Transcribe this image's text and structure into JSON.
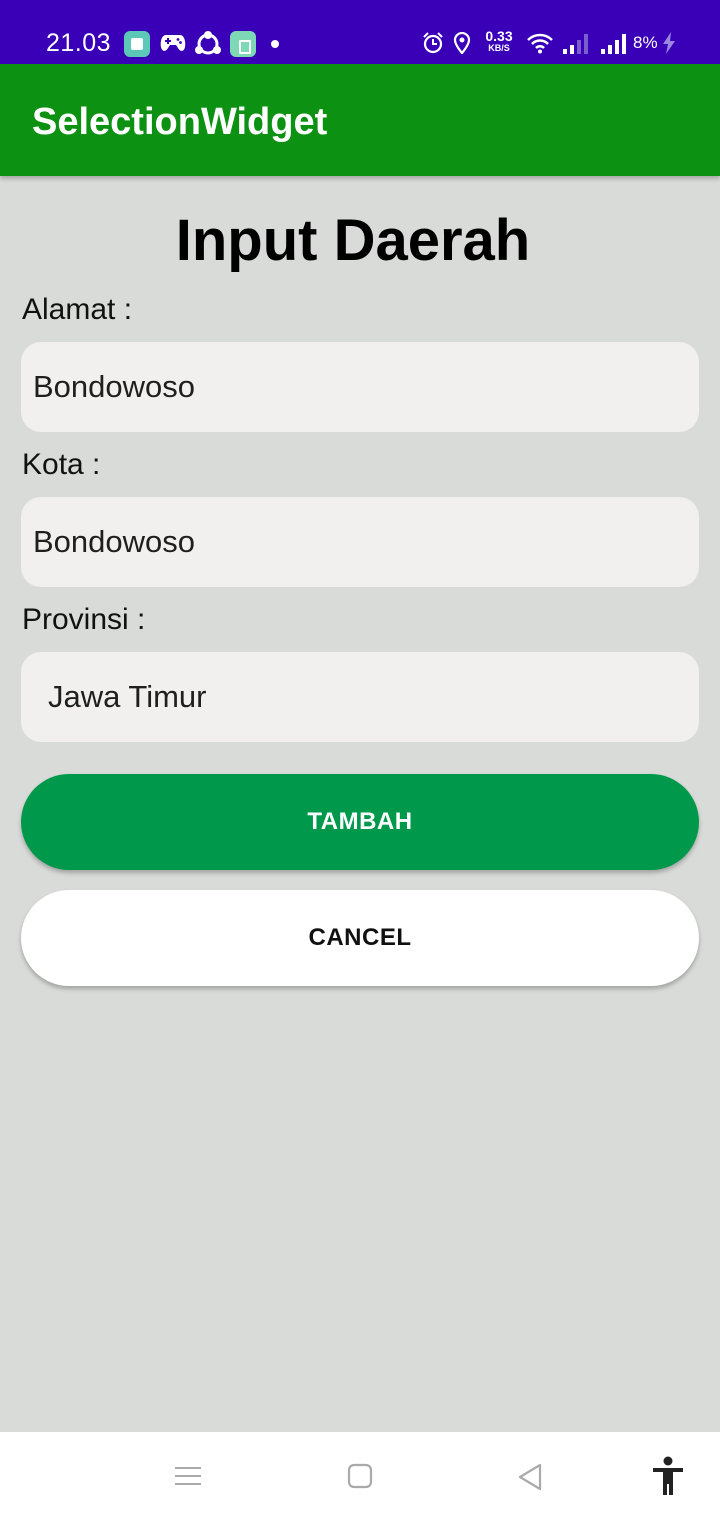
{
  "status_bar": {
    "time": "21.03",
    "network_speed_value": "0.33",
    "network_speed_unit": "KB/S",
    "battery": "8%",
    "icons": [
      "app-notification-icon",
      "game-controller-icon",
      "share-icon",
      "app-store-icon",
      "alarm-icon",
      "location-icon",
      "wifi-icon",
      "signal-icon",
      "battery-charging-icon"
    ]
  },
  "app_bar": {
    "title": "SelectionWidget",
    "color": "#0c9112"
  },
  "form": {
    "heading": "Input Daerah",
    "fields": [
      {
        "label": "Alamat :",
        "value": "Bondowoso"
      },
      {
        "label": "Kota :",
        "value": "Bondowoso"
      },
      {
        "label": "Provinsi :",
        "value": "Jawa Timur"
      }
    ]
  },
  "actions": {
    "add_label": "TAMBAH",
    "cancel_label": "CANCEL",
    "add_color": "#00994c"
  },
  "nav_bar": {
    "icons": [
      "menu-icon",
      "home-icon",
      "back-icon",
      "accessibility-icon"
    ]
  },
  "colors": {
    "status_bar": "#3a00b8",
    "background": "#d9dbd9",
    "field_background": "#f1f0ef"
  }
}
